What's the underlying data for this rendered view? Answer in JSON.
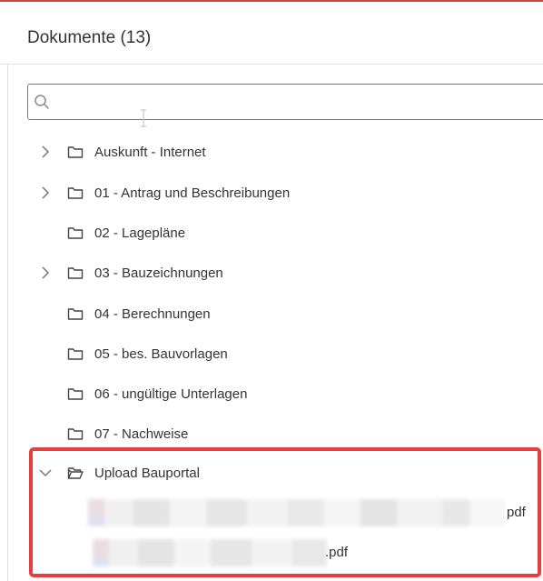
{
  "panel": {
    "title": "Dokumente (13)"
  },
  "search": {
    "value": "",
    "placeholder": ""
  },
  "tree": {
    "items": [
      {
        "label": "Auskunft - Internet",
        "expandable": true
      },
      {
        "label": "01 - Antrag und Beschreibungen",
        "expandable": true
      },
      {
        "label": "02 - Lagepläne",
        "expandable": false
      },
      {
        "label": "03 - Bauzeichnungen",
        "expandable": true
      },
      {
        "label": "04 - Berechnungen",
        "expandable": false
      },
      {
        "label": "05 - bes. Bauvorlagen",
        "expandable": false
      },
      {
        "label": "06 - ungültige Unterlagen",
        "expandable": false
      },
      {
        "label": "07 - Nachweise",
        "expandable": false
      }
    ],
    "expanded_folder": {
      "label": "Upload Bauportal",
      "expanded": true,
      "files": [
        {
          "name_visible": "pdf"
        },
        {
          "name_visible": ".pdf"
        }
      ]
    }
  },
  "colors": {
    "accent_top_rule": "#c24a45",
    "highlight_border": "#e53e3e",
    "text": "#333333"
  },
  "icons": {
    "expand": "chevron-right-icon",
    "collapse": "chevron-down-icon",
    "folder_closed": "folder-icon",
    "folder_open": "folder-open-icon",
    "search": "search-icon"
  }
}
